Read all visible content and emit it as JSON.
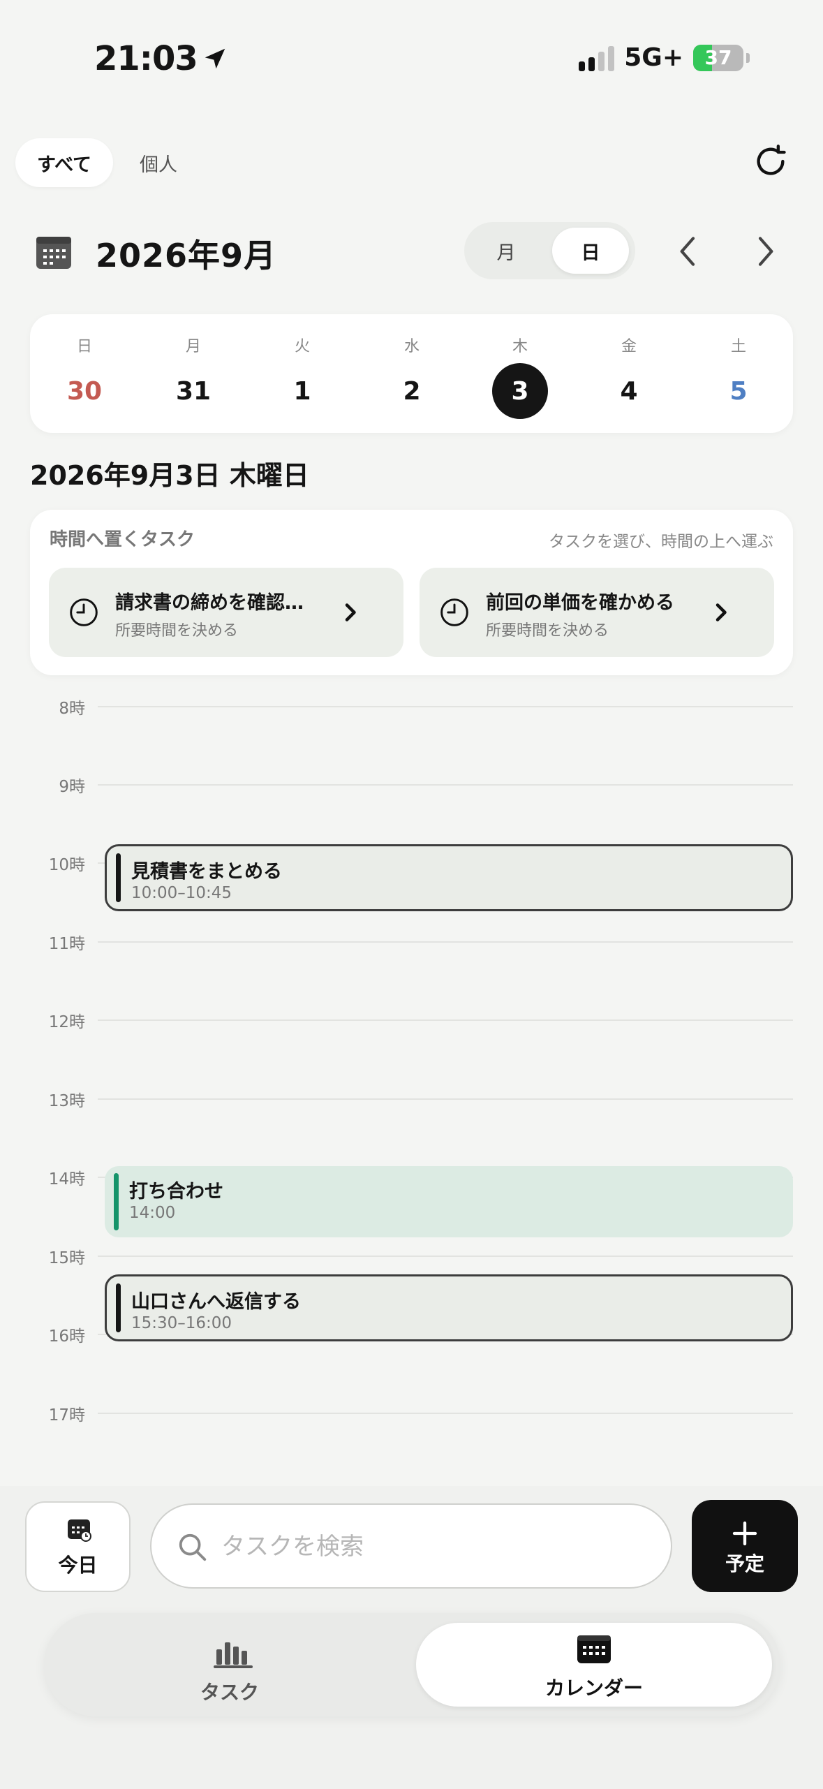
{
  "status_bar": {
    "time": "21:03",
    "network": "5G+",
    "battery": "37",
    "battery_level": 0.37
  },
  "filters": {
    "all": "すべて",
    "personal": "個人"
  },
  "header": {
    "title": "2026年9月",
    "view_month": "月",
    "view_day": "日"
  },
  "week": {
    "days": [
      {
        "dow": "日",
        "num": "30",
        "kind": "sun"
      },
      {
        "dow": "月",
        "num": "31",
        "kind": "normal"
      },
      {
        "dow": "火",
        "num": "1",
        "kind": "normal"
      },
      {
        "dow": "水",
        "num": "2",
        "kind": "normal"
      },
      {
        "dow": "木",
        "num": "3",
        "kind": "selected"
      },
      {
        "dow": "金",
        "num": "4",
        "kind": "normal"
      },
      {
        "dow": "土",
        "num": "5",
        "kind": "sat"
      }
    ]
  },
  "date_heading": "2026年9月3日 木曜日",
  "unscheduled": {
    "title": "時間へ置くタスク",
    "hint": "タスクを選び、時間の上へ運ぶ",
    "tasks": [
      {
        "title": "請求書の締めを確認…",
        "sub": "所要時間を決める"
      },
      {
        "title": "前回の単価を確かめる",
        "sub": "所要時間を決める"
      }
    ]
  },
  "timeline": {
    "hours": [
      "8時",
      "9時",
      "10時",
      "11時",
      "12時",
      "13時",
      "14時",
      "15時",
      "16時",
      "17時"
    ],
    "events": [
      {
        "title": "見積書をまとめる",
        "time": "10:00–10:45",
        "style": "outline"
      },
      {
        "title": "打ち合わせ",
        "time": "14:00",
        "style": "green"
      },
      {
        "title": "山口さんへ返信する",
        "time": "15:30–16:00",
        "style": "outline"
      }
    ]
  },
  "bottom": {
    "today": "今日",
    "search_placeholder": "タスクを検索",
    "add": "予定"
  },
  "tabs": {
    "tasks": "タスク",
    "calendar": "カレンダー"
  },
  "icons": {
    "location": "location-arrow-icon",
    "refresh": "refresh-icon",
    "calendar": "calendar-icon",
    "prev": "chevron-left-icon",
    "next": "chevron-right-icon",
    "clock": "clock-icon",
    "search": "search-icon",
    "plus": "plus-icon",
    "tasks_tab": "bar-chart-icon"
  },
  "colors": {
    "selected_day": "#151515",
    "sunday": "#c45a52",
    "saturday": "#4f7fc3",
    "event_green": "#15946a"
  }
}
